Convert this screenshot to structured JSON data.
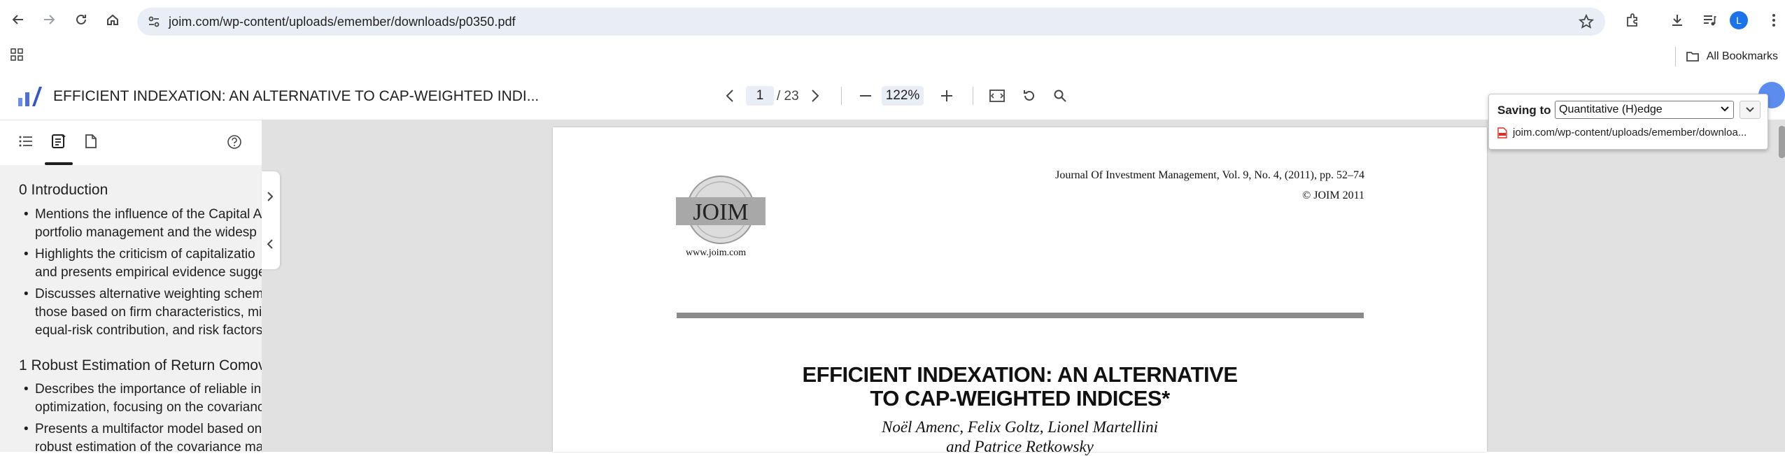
{
  "browser": {
    "url": "joim.com/wp-content/uploads/emember/downloads/p0350.pdf",
    "profile_initial": "L",
    "all_bookmarks_label": "All Bookmarks"
  },
  "pdf_toolbar": {
    "title": "EFFICIENT INDEXATION: AN ALTERNATIVE TO CAP-WEIGHTED INDI...",
    "current_page": "1",
    "total_pages": "/ 23",
    "zoom": "122%"
  },
  "sidebar": {
    "sections": [
      {
        "heading": "0 Introduction",
        "bullets": [
          [
            "Mentions the influence of the Capital A",
            "portfolio management and the widesp"
          ],
          [
            "Highlights the criticism of capitalizatio",
            "and presents empirical evidence sugge"
          ],
          [
            "Discusses alternative weighting scheme",
            "those based on firm characteristics, mi",
            "equal-risk contribution, and risk factors"
          ]
        ]
      },
      {
        "heading": "1 Robust Estimation of Return Comov",
        "bullets": [
          [
            "Describes the importance of reliable in",
            "optimization, focusing on the covarianc"
          ],
          [
            "Presents a multifactor model based on",
            "robust estimation of the covariance ma"
          ]
        ]
      }
    ]
  },
  "document": {
    "journal_line": "Journal Of Investment Management, Vol. 9, No. 4, (2011), pp. 52–74",
    "copyright": "© JOIM 2011",
    "logo_text": "JOIM",
    "logo_url": "www.joim.com",
    "title_line1": "EFFICIENT INDEXATION: AN ALTERNATIVE",
    "title_line2": "TO CAP-WEIGHTED INDICES*",
    "authors_line1": "Noël Amenc, Felix Goltz, Lionel Martellini",
    "authors_line2": "and Patrice Retkowsky"
  },
  "save_popup": {
    "label": "Saving to",
    "folder": "Quantitative (H)edge",
    "file_url": "joim.com/wp-content/uploads/emember/downloa..."
  },
  "colors": {
    "omnibox_bg": "#e9eef6",
    "viewer_bg": "#e1e1e1",
    "sidebar_bg": "#f1f1f1",
    "accent_blue": "#1a73e8",
    "logo_blue": "#4f6fd1"
  },
  "icons": [
    "back-arrow-icon",
    "forward-arrow-icon",
    "reload-icon",
    "home-icon",
    "site-settings-icon",
    "bookmark-star-icon",
    "extensions-icon",
    "downloads-icon",
    "media-controls-icon",
    "apps-grid-icon",
    "folder-icon",
    "app-logo-icon",
    "chevron-left-icon",
    "chevron-right-icon",
    "zoom-out-icon",
    "zoom-in-icon",
    "fit-page-icon",
    "rotate-icon",
    "search-icon",
    "outline-icon",
    "summary-icon",
    "thumbnails-icon",
    "help-icon",
    "pdf-file-icon"
  ]
}
